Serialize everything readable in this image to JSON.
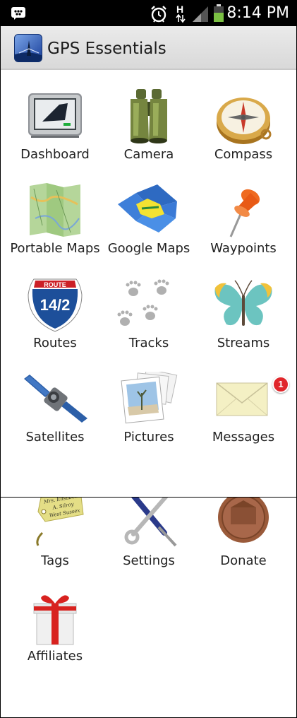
{
  "status_bar": {
    "time": "8:14 PM",
    "network_label": "H"
  },
  "action_bar": {
    "title": "GPS Essentials"
  },
  "grid": {
    "dashboard": "Dashboard",
    "camera": "Camera",
    "compass": "Compass",
    "portable_maps": "Portable Maps",
    "google_maps": "Google Maps",
    "waypoints": "Waypoints",
    "routes": "Routes",
    "tracks": "Tracks",
    "streams": "Streams",
    "satellites": "Satellites",
    "pictures": "Pictures",
    "messages": "Messages",
    "tags": "Tags",
    "settings": "Settings",
    "donate": "Donate",
    "affiliates": "Affiliates"
  },
  "routes_sign": {
    "top": "ROUTE",
    "number": "14/2"
  },
  "messages_badge": "1",
  "tag_text": [
    "Mrs. Elisabeth",
    "A. Silroy",
    "West Sussex"
  ],
  "icons": {
    "status_left": "bbm-icon",
    "alarm": "alarm-icon",
    "signal": "signal-icon",
    "battery": "battery-icon",
    "app": "gps-essentials-logo"
  },
  "colors": {
    "status_bar": "#000000",
    "action_bar": "#e2e2e2",
    "battery": "#7bc043",
    "badge": "#e0262b"
  }
}
